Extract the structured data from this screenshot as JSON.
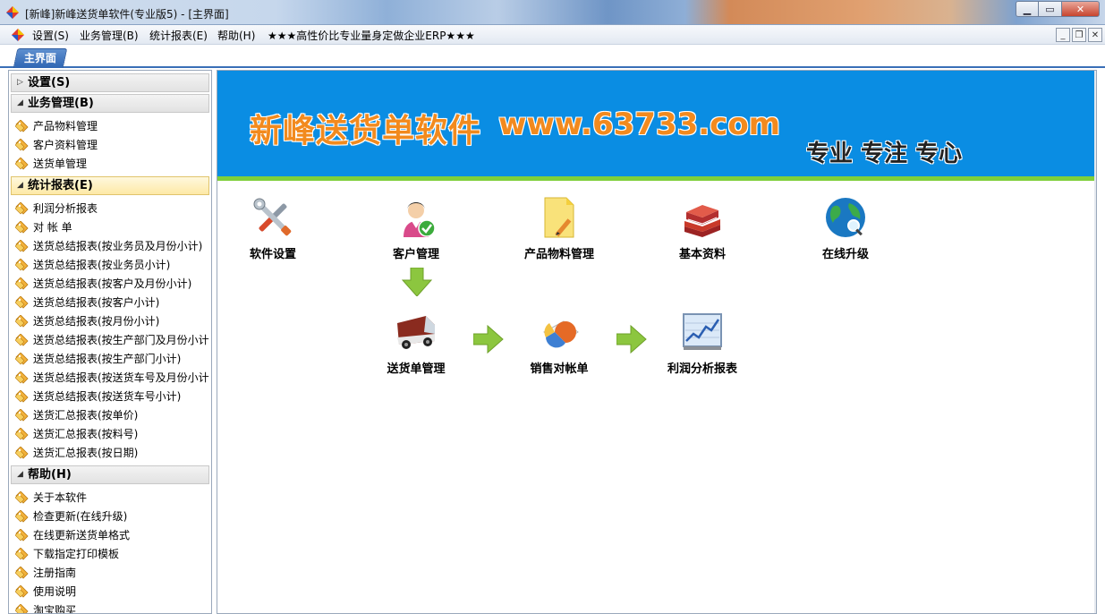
{
  "window": {
    "title": "[新峰]新峰送货单软件(专业版5) - [主界面]"
  },
  "menubar": {
    "items": [
      "设置(S)",
      "业务管理(B)",
      "统计报表(E)",
      "帮助(H)",
      "★★★高性价比专业量身定做企业ERP★★★"
    ]
  },
  "tabs": {
    "active": "主界面"
  },
  "sidebar": {
    "groups": [
      {
        "title": "设置(S)",
        "expanded": false,
        "items": []
      },
      {
        "title": "业务管理(B)",
        "expanded": true,
        "items": [
          "产品物料管理",
          "客户资料管理",
          "送货单管理"
        ]
      },
      {
        "title": "统计报表(E)",
        "expanded": true,
        "selected": true,
        "items": [
          "利润分析报表",
          "对 帐 单",
          "送货总结报表(按业务员及月份小计)",
          "送货总结报表(按业务员小计)",
          "送货总结报表(按客户及月份小计)",
          "送货总结报表(按客户小计)",
          "送货总结报表(按月份小计)",
          "送货总结报表(按生产部门及月份小计",
          "送货总结报表(按生产部门小计)",
          "送货总结报表(按送货车号及月份小计",
          "送货总结报表(按送货车号小计)",
          "送货汇总报表(按单价)",
          "送货汇总报表(按料号)",
          "送货汇总报表(按日期)"
        ]
      },
      {
        "title": "帮助(H)",
        "expanded": true,
        "items": [
          "关于本软件",
          "检查更新(在线升级)",
          "在线更新送货单格式",
          "下载指定打印模板",
          "注册指南",
          "使用说明",
          "淘宝购买"
        ]
      }
    ]
  },
  "banner": {
    "brand": "新峰送货单软件",
    "url": "www.63733.com",
    "slogan": "专业 专注 专心"
  },
  "tiles": {
    "settings": "软件设置",
    "customers": "客户管理",
    "products": "产品物料管理",
    "basic": "基本资料",
    "upgrade": "在线升级",
    "delivery": "送货单管理",
    "statement": "销售对帐单",
    "profit": "利润分析报表"
  },
  "colors": {
    "banner_bg": "#0a8de3",
    "banner_accent": "#7fcf3a",
    "brand_orange": "#f28a1e",
    "tab_blue": "#2f66b3",
    "flow_arrow": "#8cc63f"
  },
  "icons": {
    "settings": "wrench-screwdriver-icon",
    "customers": "user-check-icon",
    "products": "document-pencil-icon",
    "basic": "books-icon",
    "upgrade": "globe-search-icon",
    "delivery": "van-icon",
    "statement": "pie-chart-icon",
    "profit": "line-chart-icon"
  }
}
